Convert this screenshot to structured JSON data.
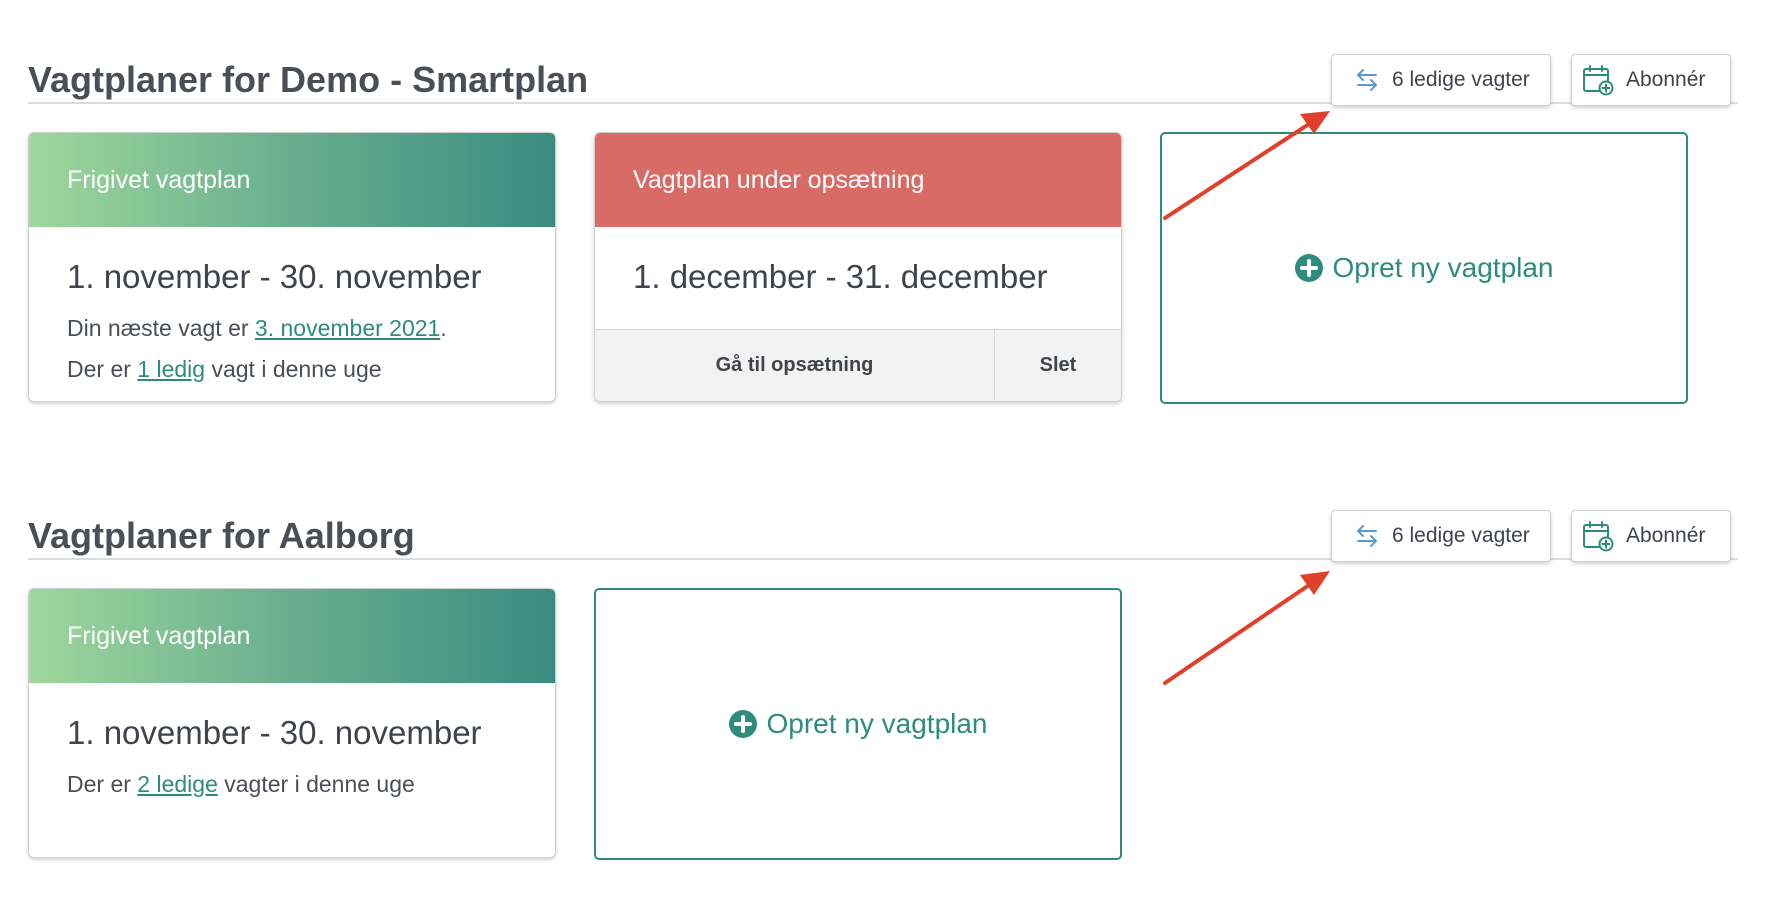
{
  "sections": [
    {
      "title": "Vagtplaner for Demo - Smartplan",
      "free_shifts_label": "6 ledige vagter",
      "subscribe_label": "Abonnér",
      "released": {
        "status": "Frigivet vagtplan",
        "period": "1. november - 30. november",
        "next_shift_prefix": "Din næste vagt er ",
        "next_shift_link": "3. november 2021",
        "next_shift_suffix": ".",
        "week_prefix": "Der er ",
        "week_link": "1 ledig",
        "week_suffix": " vagt i denne uge"
      },
      "draft": {
        "status": "Vagtplan under opsætning",
        "period": "1. december - 31. december",
        "setup_label": "Gå til opsætning",
        "delete_label": "Slet"
      },
      "create_label": "Opret ny vagtplan"
    },
    {
      "title": "Vagtplaner for Aalborg",
      "free_shifts_label": "6 ledige vagter",
      "subscribe_label": "Abonnér",
      "released": {
        "status": "Frigivet vagtplan",
        "period": "1. november - 30. november",
        "week_prefix": "Der er ",
        "week_link": "2 ledige",
        "week_suffix": " vagter i denne uge"
      },
      "create_label": "Opret ny vagtplan"
    }
  ],
  "colors": {
    "accent": "#2e8b7e",
    "released_gradient_start": "#9fd79c",
    "released_gradient_end": "#3a8c81",
    "draft_header": "#d96b67",
    "annotation_arrow": "#e0402a"
  }
}
